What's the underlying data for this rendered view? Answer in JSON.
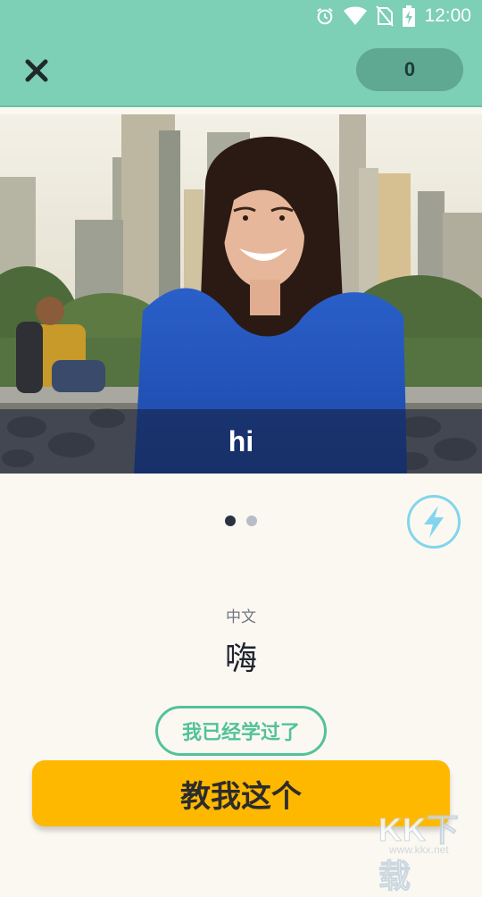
{
  "status_bar": {
    "time": "12:00",
    "icons": [
      "alarm-icon",
      "wifi-icon",
      "no-sim-icon",
      "battery-charging-icon"
    ]
  },
  "top_bar": {
    "close_icon": "close-icon",
    "score": "0",
    "background_color": "#7dcfb6"
  },
  "video": {
    "caption": "hi"
  },
  "pager": {
    "total": 2,
    "current": 1
  },
  "bolt_icon": "lightning-bolt-icon",
  "card": {
    "language_label": "中文",
    "translation": "嗨"
  },
  "buttons": {
    "already_learned": "我已经学过了",
    "teach_me": "教我这个"
  },
  "watermark": {
    "brand": "KK下载",
    "url": "www.kkx.net"
  },
  "colors": {
    "accent_teal": "#7dcfb6",
    "primary_yellow": "#ffb800",
    "green_outline": "#52c29a",
    "bolt_blue": "#82d5ec"
  }
}
